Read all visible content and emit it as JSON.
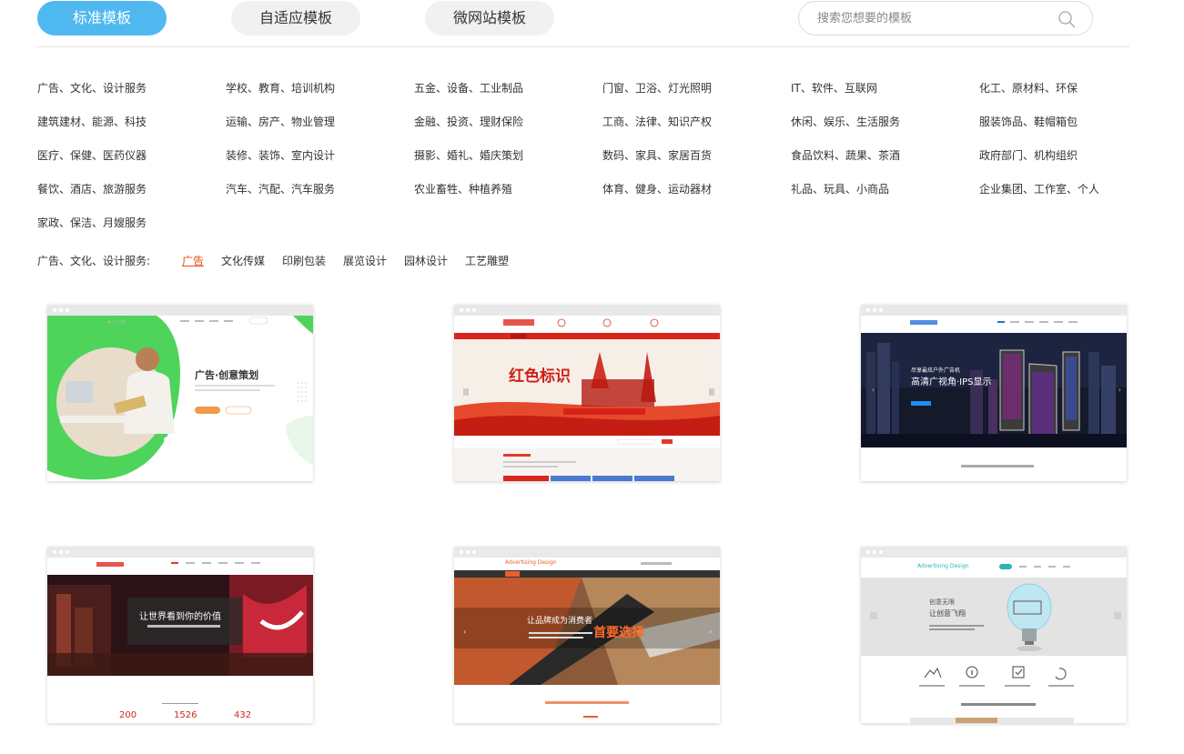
{
  "tabs": [
    {
      "label": "标准模板"
    },
    {
      "label": "自适应模板"
    },
    {
      "label": "微网站模板"
    }
  ],
  "search": {
    "placeholder": "搜索您想要的模板"
  },
  "categories": [
    "广告、文化、设计服务",
    "学校、教育、培训机构",
    "五金、设备、工业制品",
    "门窗、卫浴、灯光照明",
    "IT、软件、互联网",
    "化工、原材料、环保",
    "建筑建材、能源、科技",
    "运输、房产、物业管理",
    "金融、投资、理财保险",
    "工商、法律、知识产权",
    "休闲、娱乐、生活服务",
    "服装饰品、鞋帽箱包",
    "医疗、保健、医药仪器",
    "装修、装饰、室内设计",
    "摄影、婚礼、婚庆策划",
    "数码、家具、家居百货",
    "食品饮料、蔬果、茶酒",
    "政府部门、机构组织",
    "餐饮、酒店、旅游服务",
    "汽车、汽配、汽车服务",
    "农业畜牲、种植养殖",
    "体育、健身、运动器材",
    "礼品、玩具、小商品",
    "企业集团、工作室、个人",
    "家政、保洁、月嫂服务"
  ],
  "filter": {
    "label": "广告、文化、设计服务:",
    "items": [
      "广告",
      "文化传媒",
      "印刷包装",
      "展览设计",
      "园林设计",
      "工艺雕塑"
    ],
    "active": "广告"
  },
  "templates": [
    {
      "headline": "广告·创意策划"
    },
    {
      "headline": "红色标识"
    },
    {
      "headline": "高清广视角·IPS显示",
      "kicker": "尽享最炫户外广告机"
    },
    {
      "headline": "让世界看到你的价值",
      "stats": [
        "200",
        "1526",
        "432"
      ]
    },
    {
      "headline": "首要选择",
      "lead": "让品牌成为消费者",
      "brand": "Advertising Design"
    },
    {
      "headline": "让创意飞翔",
      "lead": "创意无限",
      "brand": "Advertising Design"
    }
  ],
  "colors": {
    "accent": "#4fb8f0",
    "active_filter": "#e2531b"
  }
}
